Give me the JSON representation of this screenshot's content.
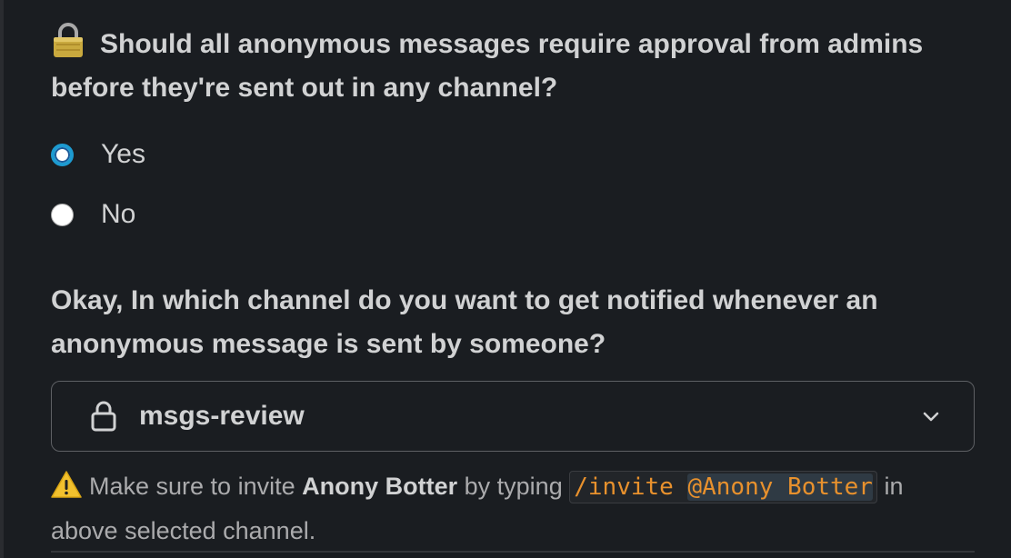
{
  "approval_question": {
    "emoji": "lock-icon",
    "text": "Should all anonymous messages require approval from admins before they're sent out in any channel?"
  },
  "approval_options": [
    {
      "label": "Yes",
      "selected": true
    },
    {
      "label": "No",
      "selected": false
    }
  ],
  "channel_question": {
    "text": "Okay, In which channel do you want to get notified whenever an anonymous message is sent by someone?"
  },
  "channel_select": {
    "icon": "lock-outline-icon",
    "value": "msgs-review",
    "chevron": "chevron-down-icon"
  },
  "hint": {
    "icon": "warning-icon",
    "prefix": "Make sure to invite",
    "bot_name": "Anony Botter",
    "middle": "by typing",
    "command": "/invite",
    "mention": "@Anony Botter",
    "suffix": "in above selected channel."
  },
  "colors": {
    "background": "#1a1d21",
    "text": "#d1d2d3",
    "accent": "#1d9bd1",
    "code": "#e8912d"
  }
}
